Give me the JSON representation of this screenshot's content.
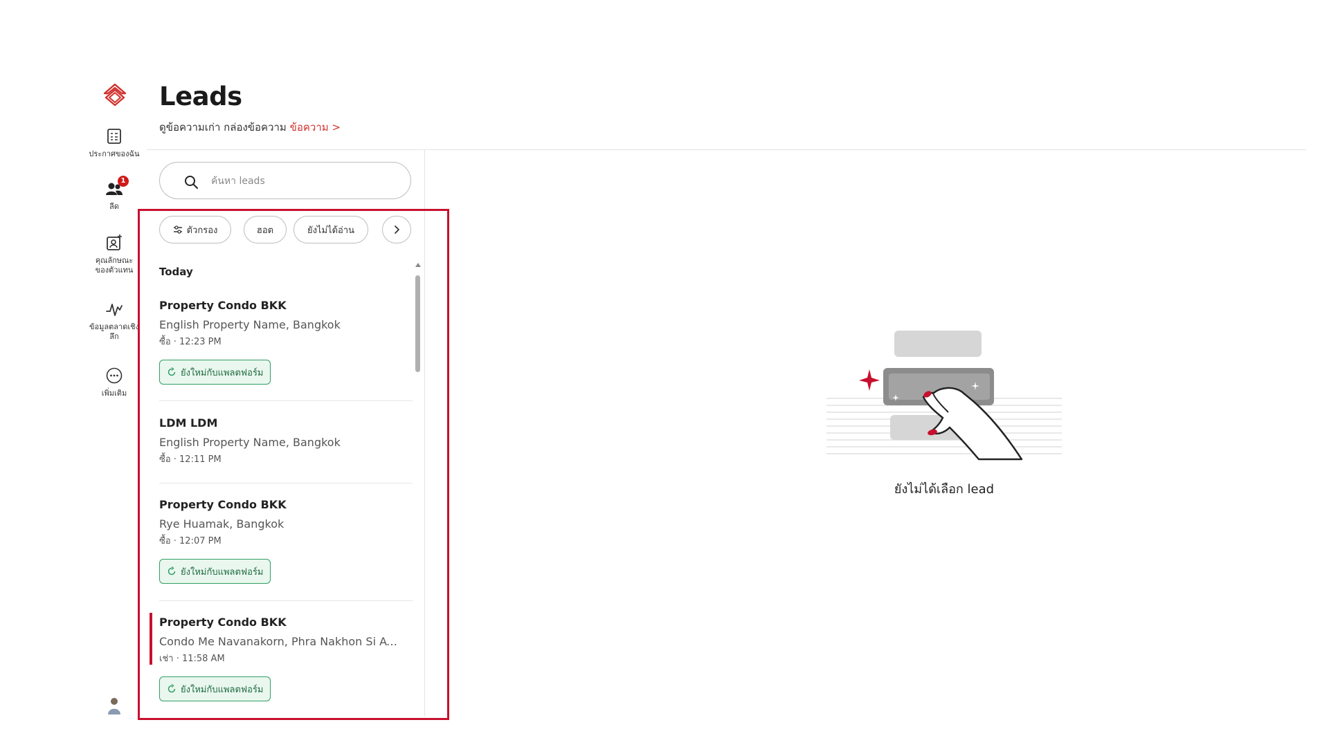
{
  "sidebar": {
    "items": [
      {
        "label": "ประกาศของฉัน",
        "icon": "listing-icon"
      },
      {
        "label": "ลีด",
        "icon": "leads-icon",
        "badge": "1"
      },
      {
        "label": "คุณลักษณะ\nของตัวแทน",
        "icon": "agent-profile-icon"
      },
      {
        "label": "ข้อมูลตลาดเชิง\nลึก",
        "icon": "market-insights-icon"
      },
      {
        "label": "เพิ่มเติม",
        "icon": "more-icon"
      }
    ]
  },
  "header": {
    "title": "Leads",
    "subtitle": "ดูข้อความเก่า กล่องข้อความ",
    "subtitle_link": "ข้อความ >"
  },
  "search": {
    "placeholder": "ค้นหา leads",
    "value": ""
  },
  "filters": [
    {
      "label": "ตัวกรอง",
      "icon": "filter-icon"
    },
    {
      "label": "ฮอต"
    },
    {
      "label": "ยังไม่ได้อ่าน"
    }
  ],
  "list": {
    "section": "Today",
    "leads": [
      {
        "name": "Property Condo BKK",
        "property": "English Property Name, Bangkok",
        "meta": "ซื้อ · 12:23 PM",
        "tag": "ยังใหม่กับแพลตฟอร์ม"
      },
      {
        "name": "LDM LDM",
        "property": "English Property Name, Bangkok",
        "meta": "ซื้อ · 12:11 PM",
        "tag": ""
      },
      {
        "name": "Property Condo BKK",
        "property": "Rye Huamak, Bangkok",
        "meta": "ซื้อ · 12:07 PM",
        "tag": "ยังใหม่กับแพลตฟอร์ม"
      },
      {
        "name": "Property Condo BKK",
        "property": "Condo Me Navanakorn, Phra Nakhon Si Ay...",
        "meta": "เช่า · 11:58 AM",
        "tag": "ยังใหม่กับแพลตฟอร์ม"
      }
    ]
  },
  "empty_state": {
    "text": "ยังไม่ได้เลือก lead"
  },
  "colors": {
    "accent": "#c8102e",
    "tag_green": "#2f9e62",
    "tag_bg": "#eaf7ef"
  }
}
